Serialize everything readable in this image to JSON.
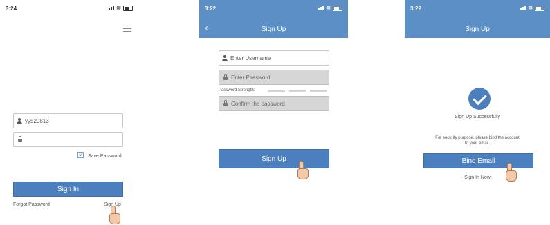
{
  "screen1": {
    "status_time": "3:24",
    "username_value": "yy520813",
    "password_value": "",
    "save_password_label": "Save Password",
    "sign_in_label": "Sign In",
    "forgot_password_label": "Forgot Password",
    "sign_up_label": "Sign Up"
  },
  "screen2": {
    "status_time": "3:22",
    "nav_title": "Sign Up",
    "username_placeholder": "Enter Username",
    "password_placeholder": "Enter Password",
    "strength_label": "Password Strength:",
    "confirm_placeholder": "Confirm the password",
    "sign_up_label": "Sign Up"
  },
  "screen3": {
    "status_time": "3:22",
    "nav_title": "Sign Up",
    "success_text": "Sign Up Successfully",
    "security_text_line1": "For security purpose, please bind the account",
    "security_text_line2": "to your email.",
    "bind_email_label": "Bind Email",
    "sign_in_now_label": "- Sign In Now -"
  },
  "icons": [
    "menu-icon",
    "user-icon",
    "lock-icon",
    "back-chevron-icon",
    "checkmark-icon",
    "hand-pointer-icon"
  ],
  "colors": {
    "nav_blue": "#5b8fc6",
    "button_blue": "#4b7fbd",
    "field_gray": "#d6d6d6"
  }
}
